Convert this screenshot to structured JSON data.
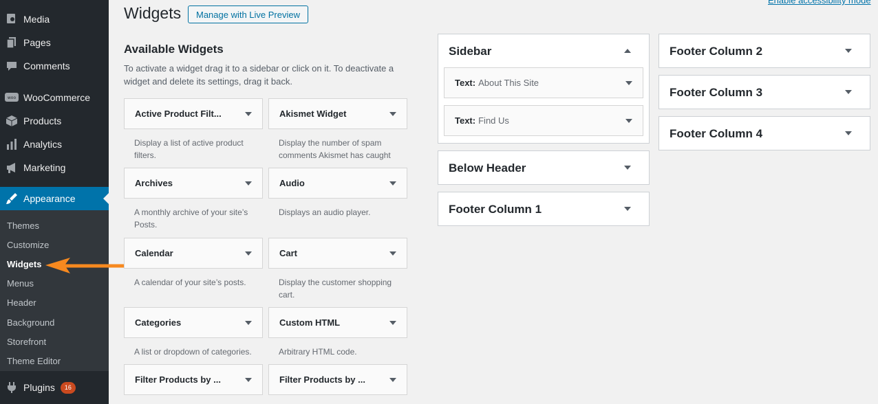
{
  "sidebar": {
    "items": [
      {
        "label": "Media",
        "icon": "media-icon"
      },
      {
        "label": "Pages",
        "icon": "pages-icon"
      },
      {
        "label": "Comments",
        "icon": "comments-icon"
      },
      {
        "label": "WooCommerce",
        "icon": "woocommerce-icon"
      },
      {
        "label": "Products",
        "icon": "products-icon"
      },
      {
        "label": "Analytics",
        "icon": "analytics-icon"
      },
      {
        "label": "Marketing",
        "icon": "marketing-icon"
      },
      {
        "label": "Appearance",
        "icon": "appearance-icon"
      },
      {
        "label": "Plugins",
        "icon": "plugins-icon",
        "badge": "16"
      }
    ],
    "submenu": [
      "Themes",
      "Customize",
      "Widgets",
      "Menus",
      "Header",
      "Background",
      "Storefront",
      "Theme Editor"
    ],
    "current_sub": "Widgets"
  },
  "header": {
    "title": "Widgets",
    "live_preview_button": "Manage with Live Preview",
    "accessibility_link": "Enable accessibility mode"
  },
  "available": {
    "title": "Available Widgets",
    "description": "To activate a widget drag it to a sidebar or click on it. To deactivate a widget and delete its settings, drag it back.",
    "widgets": [
      {
        "name": "Active Product Filt...",
        "desc": "Display a list of active product filters."
      },
      {
        "name": "Akismet Widget",
        "desc": "Display the number of spam comments Akismet has caught"
      },
      {
        "name": "Archives",
        "desc": "A monthly archive of your site’s Posts."
      },
      {
        "name": "Audio",
        "desc": "Displays an audio player."
      },
      {
        "name": "Calendar",
        "desc": "A calendar of your site’s posts."
      },
      {
        "name": "Cart",
        "desc": "Display the customer shopping cart."
      },
      {
        "name": "Categories",
        "desc": "A list or dropdown of categories."
      },
      {
        "name": "Custom HTML",
        "desc": "Arbitrary HTML code."
      },
      {
        "name": "Filter Products by ...",
        "desc": ""
      },
      {
        "name": "Filter Products by ...",
        "desc": ""
      }
    ]
  },
  "areas": {
    "sidebar": {
      "title": "Sidebar",
      "widgets": [
        {
          "type": "Text:",
          "title": "About This Site"
        },
        {
          "type": "Text:",
          "title": "Find Us"
        }
      ]
    },
    "below_header": {
      "title": "Below Header"
    },
    "footer1": {
      "title": "Footer Column 1"
    },
    "footer2": {
      "title": "Footer Column 2"
    },
    "footer3": {
      "title": "Footer Column 3"
    },
    "footer4": {
      "title": "Footer Column 4"
    }
  },
  "colors": {
    "sidebar_bg": "#23282d",
    "submenu_bg": "#32373c",
    "accent": "#0073aa",
    "badge": "#ca4a1f",
    "annotation_arrow": "#f7891f"
  }
}
